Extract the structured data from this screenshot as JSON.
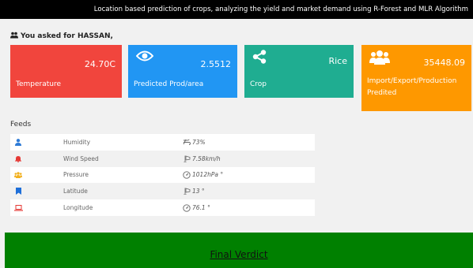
{
  "header": {
    "title": "Location based prediction of crops, analyzing the yield and market demand using R-Forest and MLR Algorithm"
  },
  "query": {
    "text": "You asked for HASSAN,"
  },
  "cards": [
    {
      "value": "24.70C",
      "label": "Temperature",
      "icon": "thermometer-icon",
      "color": "#f1453d"
    },
    {
      "value": "2.5512",
      "label": "Predicted Prod/area",
      "icon": "eye-icon",
      "color": "#2196f3"
    },
    {
      "value": "Rice",
      "label": "Crop",
      "icon": "share-icon",
      "color": "#1fad91"
    },
    {
      "value": "35448.09",
      "label": "Import/Export/Production Predited",
      "icon": "users-icon",
      "color": "#fe9800"
    }
  ],
  "feeds": {
    "title": "Feeds",
    "rows": [
      {
        "name": "Humidity",
        "value": "73%",
        "icon": "user-icon",
        "value_icon": "wind-icon"
      },
      {
        "name": "Wind Speed",
        "value": "7.58km/h",
        "icon": "bell-icon",
        "value_icon": "wind-sock-icon"
      },
      {
        "name": "Pressure",
        "value": "1012hPa °",
        "icon": "users-icon",
        "value_icon": "gauge-icon"
      },
      {
        "name": "Latitude",
        "value": "13 °",
        "icon": "bookmark-icon",
        "value_icon": "wind-sock-icon"
      },
      {
        "name": "Longitude",
        "value": "76.1 °",
        "icon": "laptop-icon",
        "value_icon": "gauge-icon"
      }
    ]
  },
  "verdict": {
    "label": "Final Verdict",
    "bg": "#008000"
  }
}
